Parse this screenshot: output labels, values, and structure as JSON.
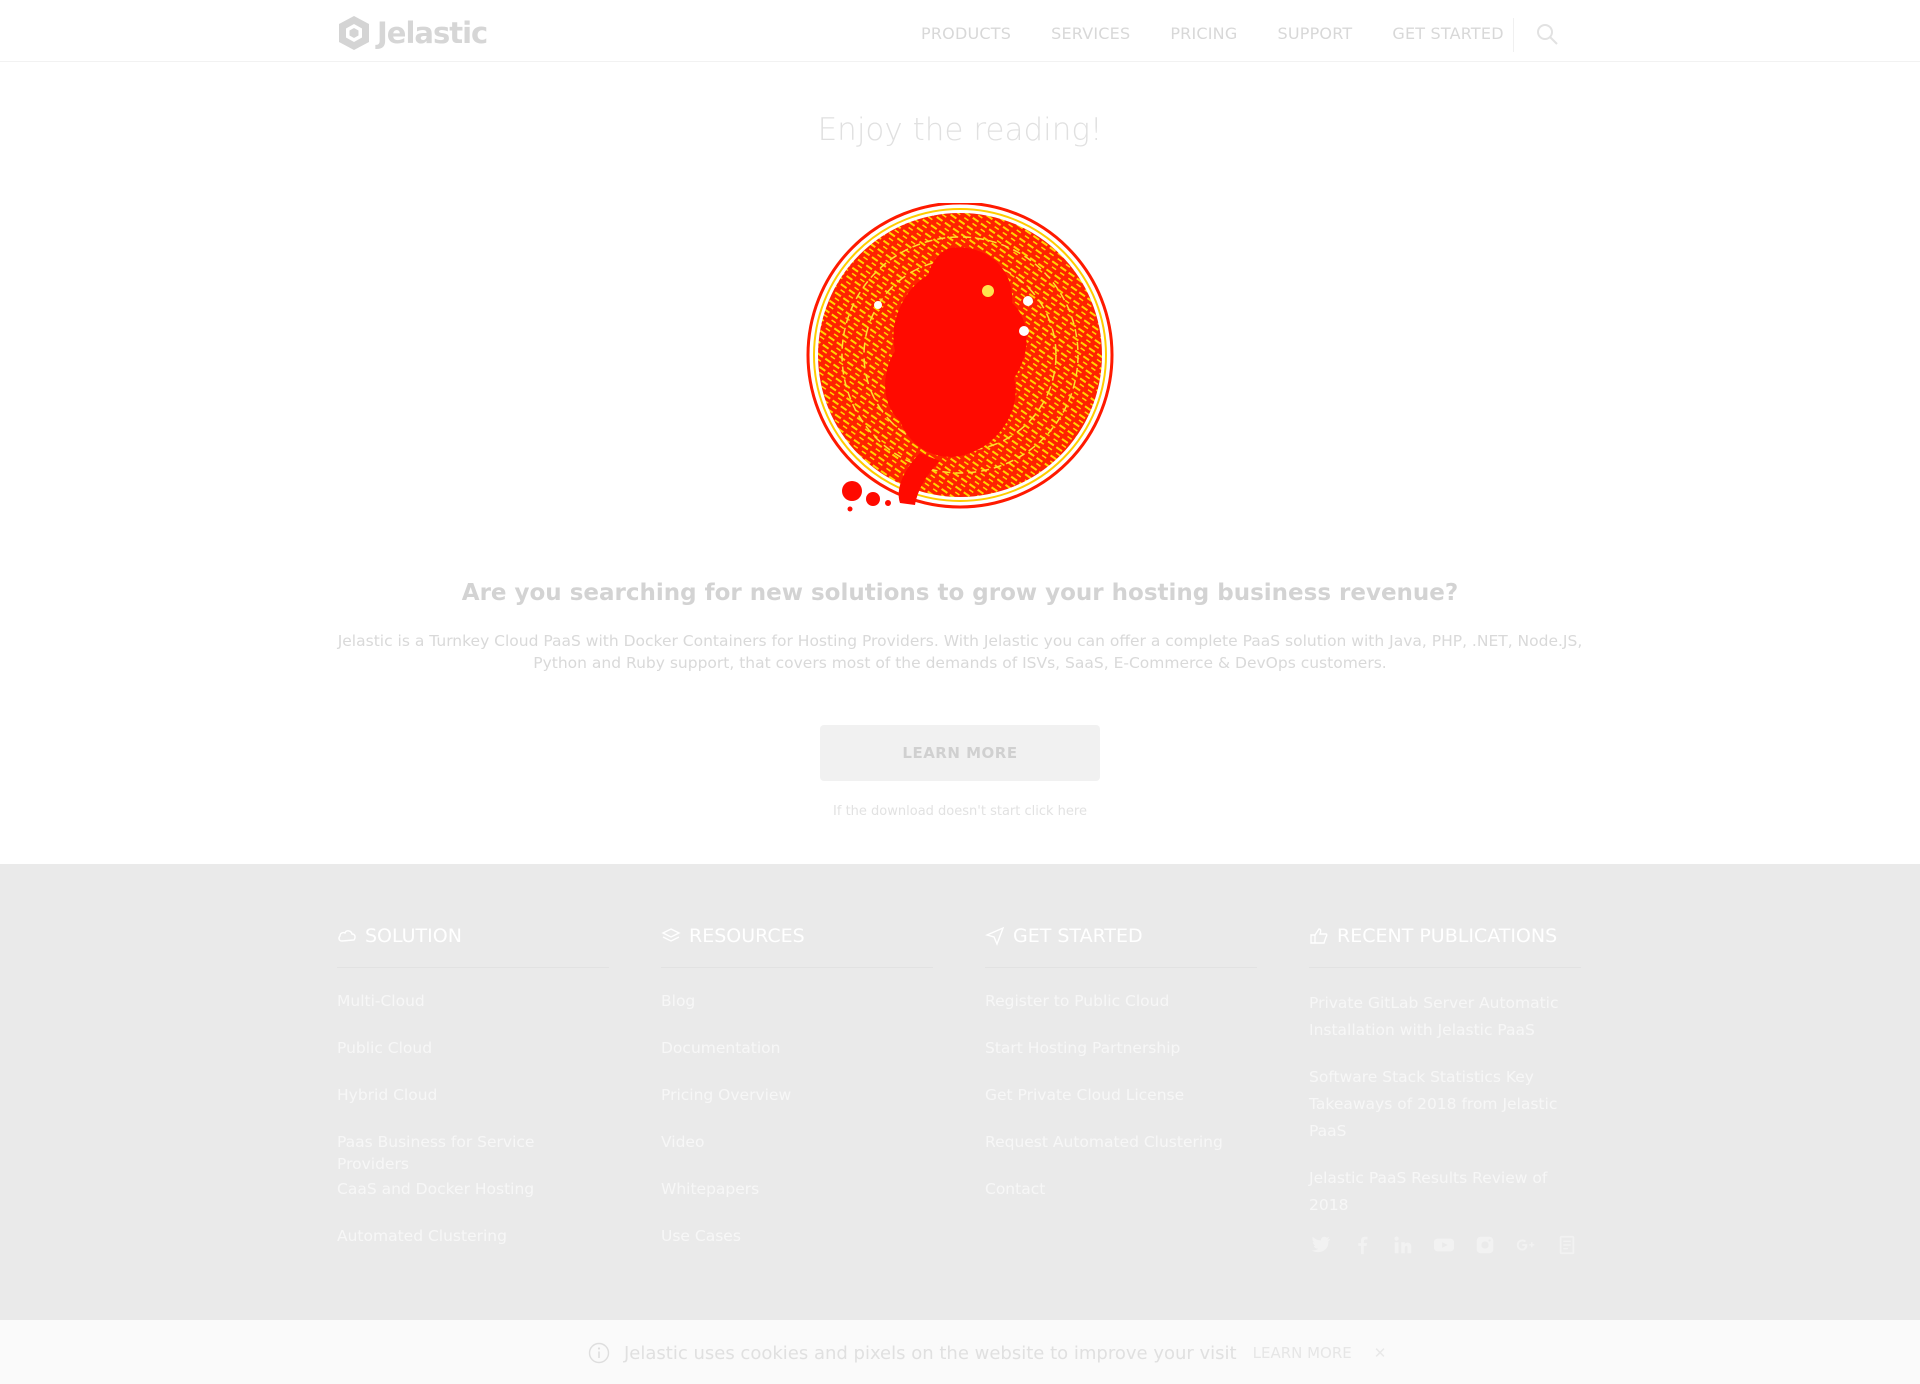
{
  "header": {
    "logo_text": "Jelastic",
    "nav": [
      "PRODUCTS",
      "SERVICES",
      "PRICING",
      "SUPPORT",
      "GET STARTED"
    ]
  },
  "hero": {
    "title": "Enjoy the reading!",
    "question": "Are you searching for new solutions to grow your hosting business revenue?",
    "description": "Jelastic is a Turnkey Cloud PaaS with Docker Containers for Hosting Providers. With Jelastic you can offer a complete PaaS solution with Java, PHP, .NET, Node.JS, Python and Ruby support, that covers most of the demands of ISVs, SaaS, E-Commerce & DevOps customers.",
    "button": "LEARN MORE",
    "download_hint": "If the download doesn't start click here"
  },
  "footer": {
    "solution": {
      "title": "SOLUTION",
      "links": [
        "Multi-Cloud",
        "Public Cloud",
        "Hybrid Cloud",
        "Paas Business for Service Providers",
        "CaaS and Docker Hosting",
        "Automated Clustering"
      ]
    },
    "resources": {
      "title": "RESOURCES",
      "links": [
        "Blog",
        "Documentation",
        "Pricing Overview",
        "Video",
        "Whitepapers",
        "Use Cases"
      ]
    },
    "get_started": {
      "title": "GET STARTED",
      "links": [
        "Register to Public Cloud",
        "Start Hosting Partnership",
        "Get Private Cloud License",
        "Request Automated Clustering",
        "Contact"
      ]
    },
    "publications": {
      "title": "RECENT PUBLICATIONS",
      "items": [
        "Private GitLab Server Automatic Installation with Jelastic PaaS",
        "Software Stack Statistics Key Takeaways of 2018 from Jelastic PaaS",
        "Jelastic PaaS Results Review of 2018"
      ]
    },
    "socials": [
      "twitter-icon",
      "facebook-icon",
      "linkedin-icon",
      "youtube-icon",
      "instagram-icon",
      "google-plus-icon",
      "rss-icon"
    ]
  },
  "cookie": {
    "text": "Jelastic uses cookies and pixels on the website to improve your visit",
    "link": "LEARN MORE",
    "close": "✕"
  },
  "colors": {
    "accent_red": "#ff0000",
    "accent_yellow": "#ffcc00",
    "footer_bg": "#eaeaea"
  }
}
